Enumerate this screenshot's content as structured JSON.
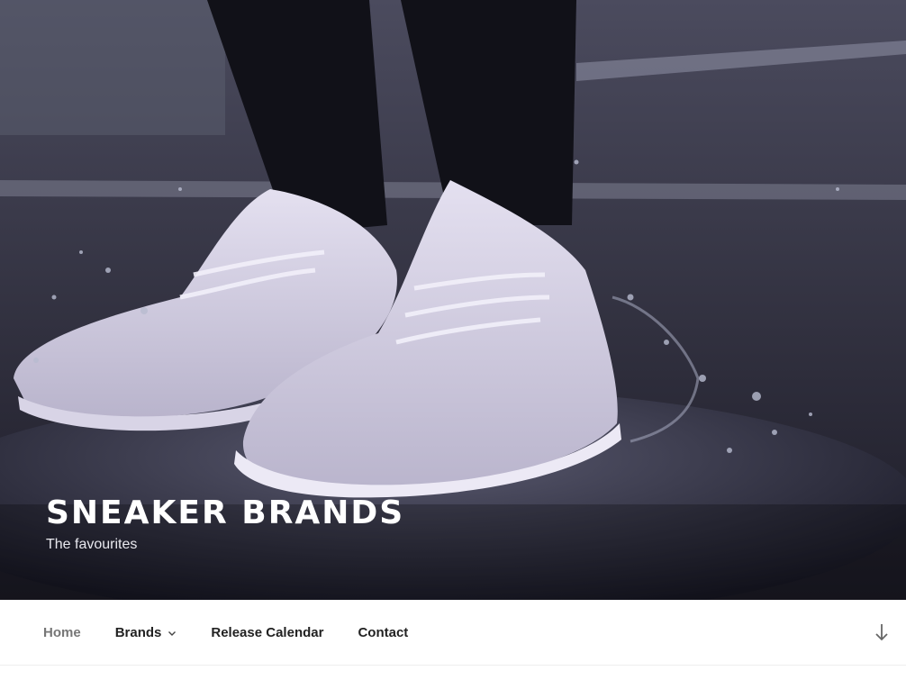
{
  "header": {
    "site_title": "SNEAKER BRANDS",
    "site_description": "The favourites"
  },
  "navigation": {
    "items": [
      {
        "label": "Home",
        "current": true
      },
      {
        "label": "Brands",
        "has_submenu": true
      },
      {
        "label": "Release Calendar"
      },
      {
        "label": "Contact"
      }
    ],
    "scroll_icon": "arrow-down-icon",
    "submenu_icon": "chevron-down-icon"
  },
  "colors": {
    "nav_text": "#222222",
    "nav_current": "#767676",
    "title": "#ffffff"
  }
}
